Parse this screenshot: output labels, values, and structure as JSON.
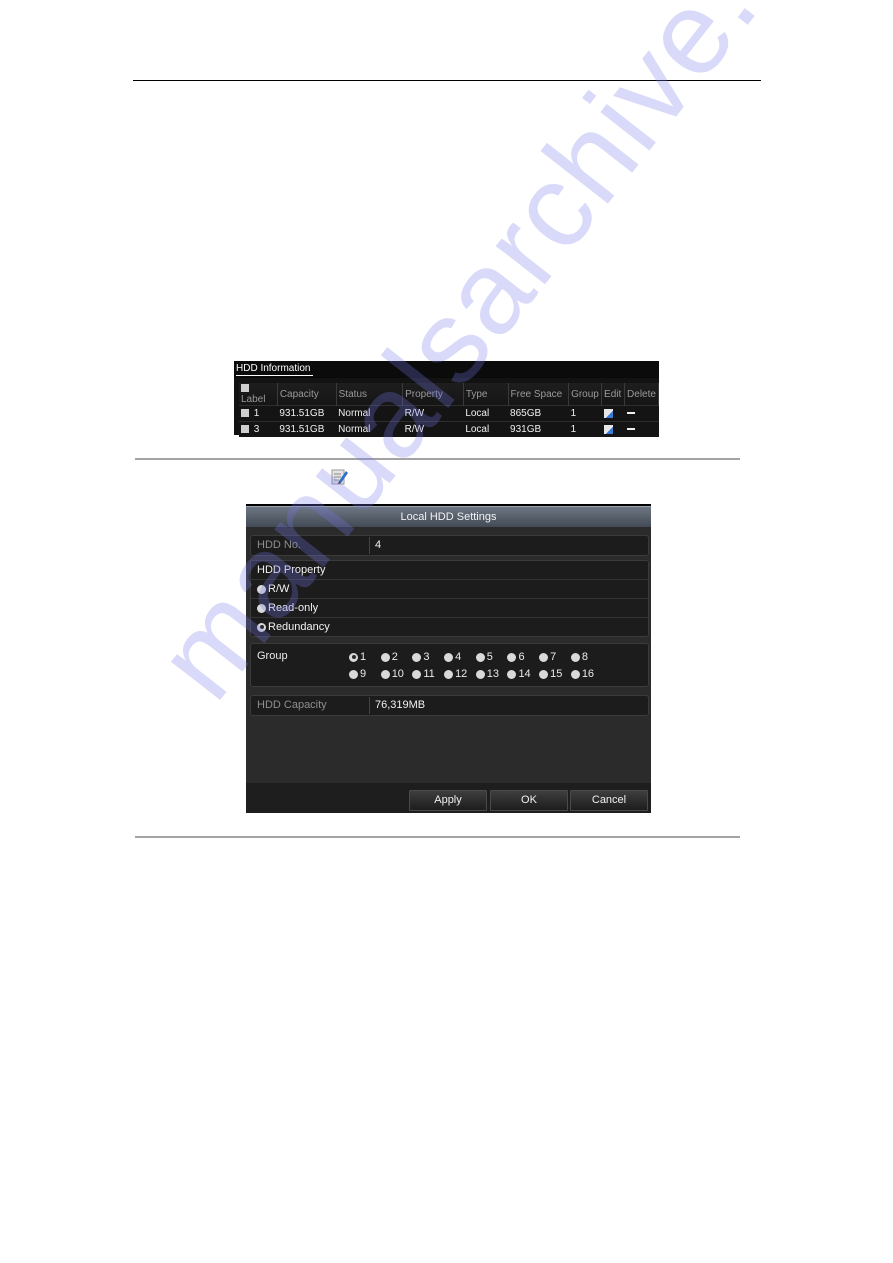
{
  "watermark": "manualsarchive.com",
  "hdd_information": {
    "title": "HDD Information",
    "columns": [
      "Label",
      "Capacity",
      "Status",
      "Property",
      "Type",
      "Free Space",
      "Group",
      "Edit",
      "Delete"
    ],
    "rows": [
      {
        "label": "1",
        "capacity": "931.51GB",
        "status": "Normal",
        "property": "R/W",
        "type": "Local",
        "free_space": "865GB",
        "group": "1"
      },
      {
        "label": "3",
        "capacity": "931.51GB",
        "status": "Normal",
        "property": "R/W",
        "type": "Local",
        "free_space": "931GB",
        "group": "1"
      }
    ]
  },
  "inline_icon": "edit-icon",
  "dialog": {
    "title": "Local HDD Settings",
    "hdd_no": {
      "label": "HDD No.",
      "value": "4"
    },
    "hdd_property": {
      "label": "HDD Property",
      "options": [
        {
          "label": "R/W",
          "selected": false
        },
        {
          "label": "Read-only",
          "selected": false
        },
        {
          "label": "Redundancy",
          "selected": true
        }
      ]
    },
    "group": {
      "label": "Group",
      "options": [
        "1",
        "2",
        "3",
        "4",
        "5",
        "6",
        "7",
        "8",
        "9",
        "10",
        "11",
        "12",
        "13",
        "14",
        "15",
        "16"
      ],
      "selected": "1"
    },
    "hdd_capacity": {
      "label": "HDD Capacity",
      "value": "76,319MB"
    },
    "buttons": {
      "apply": "Apply",
      "ok": "OK",
      "cancel": "Cancel"
    }
  },
  "colors": {
    "dialog_bg": "#2b2b2b",
    "panel_bg": "#1c1c1c",
    "title_gradient_top": "#6d7683",
    "title_gradient_bottom": "#434a55",
    "watermark": "#7878eb"
  }
}
